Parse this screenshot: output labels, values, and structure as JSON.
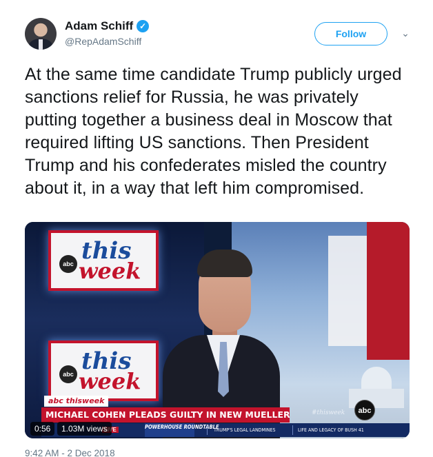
{
  "author": {
    "display_name": "Adam Schiff",
    "verified_mark": "✓",
    "handle": "@RepAdamSchiff"
  },
  "actions": {
    "follow_label": "Follow",
    "more_caret": "⌄"
  },
  "tweet_text": "At the same time candidate Trump publicly urged sanctions relief for Russia, he was privately putting together a business deal in Moscow that required lifting US sanctions. Then President Trump and his confederates misled the country about it, in a way that left him compromised.",
  "media": {
    "duration": "0:56",
    "views": "1.03M views",
    "show_word_top": "this",
    "show_word_bottom": "week",
    "abc_small": "abc",
    "lower_third": {
      "brand": "abc thisweek",
      "headline": "MICHAEL COHEN PLEADS GUILTY IN NEW MUELLER DEAL",
      "hashtag": "#thisweek",
      "network_logo": "abc",
      "live": "LIVE",
      "ticker_powerhouse": "POWERHOUSE ROUNDTABLE",
      "ticker_item_1": "TRUMP'S LEGAL LANDMINES",
      "ticker_item_2": "LIFE AND LEGACY OF BUSH 41"
    }
  },
  "timestamp": "9:42 AM - 2 Dec 2018",
  "colors": {
    "accent": "#1da1f2",
    "text": "#14171a",
    "secondary": "#657786",
    "banner_red": "#c3132c",
    "ticker_blue": "#132a63"
  }
}
